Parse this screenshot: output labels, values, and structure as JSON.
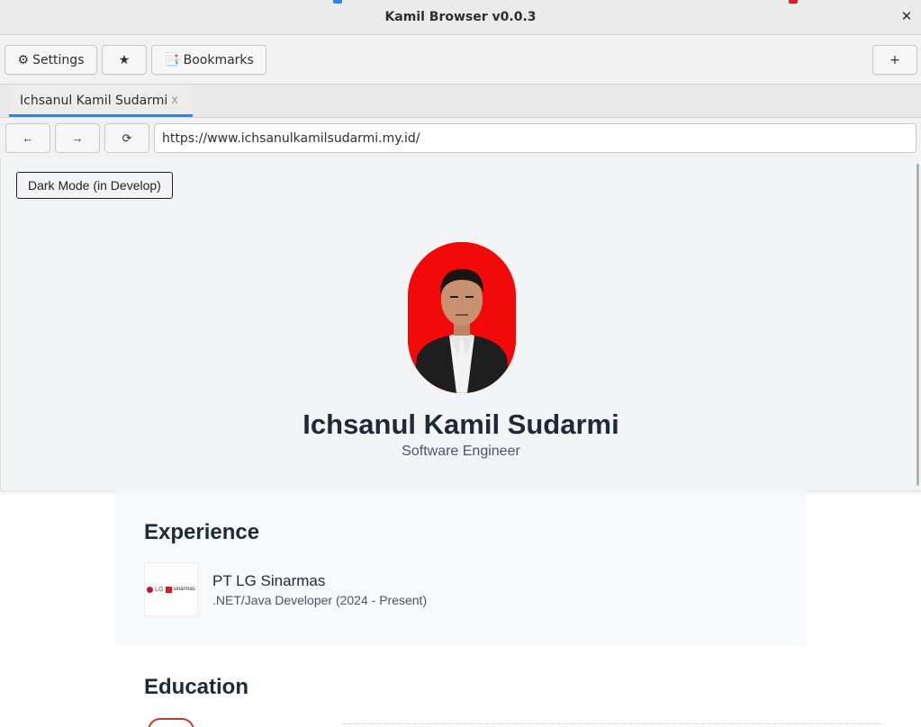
{
  "window": {
    "title": "Kamil Browser v0.0.3",
    "close_glyph": "✕"
  },
  "toolbar": {
    "settings_icon": "⚙",
    "settings_label": "Settings",
    "star_label": "★",
    "bookmarks_icon": "📑",
    "bookmarks_label": "Bookmarks",
    "new_tab_label": "+"
  },
  "tabs": [
    {
      "label": "Ichsanul Kamil Sudarmi",
      "close_glyph": "x",
      "active": true
    }
  ],
  "navigation": {
    "back_label": "←",
    "forward_label": "→",
    "reload_label": "⟳",
    "url": "https://www.ichsanulkamilsudarmi.my.id/"
  },
  "page": {
    "dark_mode_button": "Dark Mode (in Develop)",
    "profile": {
      "name": "Ichsanul Kamil Sudarmi",
      "role": "Software Engineer"
    },
    "experience": {
      "heading": "Experience",
      "items": [
        {
          "logo_text": "LG",
          "logo_text2": "sinarmas",
          "company": "PT LG Sinarmas",
          "position": ".NET/Java Developer (2024 - Present)"
        }
      ]
    },
    "education": {
      "heading": "Education"
    }
  },
  "colors": {
    "tab_accent": "#3584e4",
    "avatar_background": "#f20a0a",
    "hero_background": "#f3f4f6",
    "heading_text": "#1f2937"
  }
}
